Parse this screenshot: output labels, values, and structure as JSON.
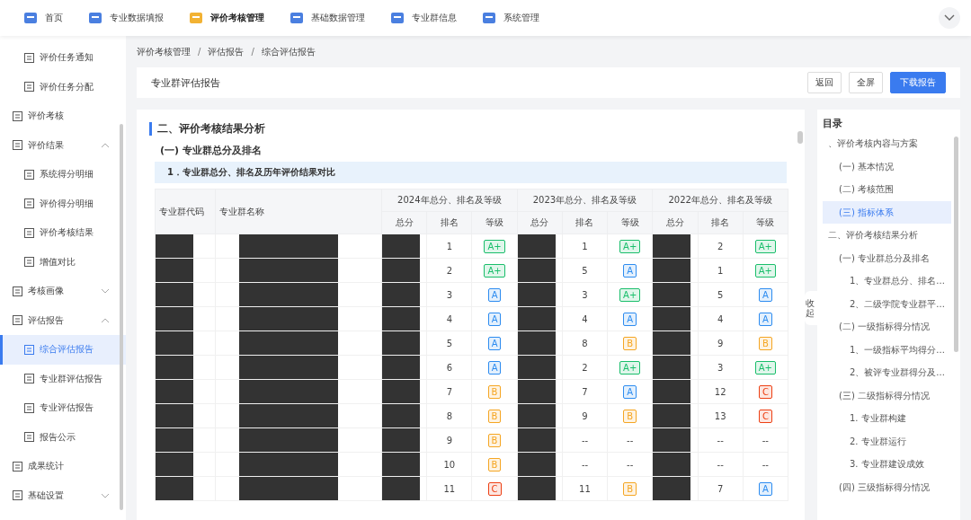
{
  "top_nav": {
    "items": [
      {
        "label": "首页",
        "selected": false
      },
      {
        "label": "专业数据填报",
        "selected": false
      },
      {
        "label": "评价考核管理",
        "selected": true
      },
      {
        "label": "基础数据管理",
        "selected": false
      },
      {
        "label": "专业群信息",
        "selected": false
      },
      {
        "label": "系统管理",
        "selected": false
      }
    ]
  },
  "sidebar": {
    "items": [
      {
        "label": "评价任务通知",
        "kind": "sub",
        "selected": false
      },
      {
        "label": "评价任务分配",
        "kind": "sub",
        "selected": false
      },
      {
        "label": "评价考核",
        "kind": "group",
        "selected": false
      },
      {
        "label": "评价结果",
        "kind": "folder",
        "expanded": true,
        "selected": false
      },
      {
        "label": "系统得分明细",
        "kind": "sub",
        "selected": false
      },
      {
        "label": "评价得分明细",
        "kind": "sub",
        "selected": false
      },
      {
        "label": "评价考核结果",
        "kind": "sub",
        "selected": false
      },
      {
        "label": "增值对比",
        "kind": "sub",
        "selected": false
      },
      {
        "label": "考核画像",
        "kind": "folder",
        "expanded": false,
        "selected": false
      },
      {
        "label": "评估报告",
        "kind": "folder",
        "expanded": true,
        "selected": false
      },
      {
        "label": "综合评估报告",
        "kind": "sub",
        "selected": true
      },
      {
        "label": "专业群评估报告",
        "kind": "sub",
        "selected": false
      },
      {
        "label": "专业评估报告",
        "kind": "sub",
        "selected": false
      },
      {
        "label": "报告公示",
        "kind": "sub",
        "selected": false
      },
      {
        "label": "成果统计",
        "kind": "group",
        "selected": false
      },
      {
        "label": "基础设置",
        "kind": "folder",
        "expanded": false,
        "selected": false
      }
    ]
  },
  "breadcrumb": [
    "评价考核管理",
    "评估报告",
    "综合评估报告"
  ],
  "breadcrumb_separator": "/",
  "page_title": "专业群评估报告",
  "buttons": [
    {
      "label": "返回",
      "kind": "plain"
    },
    {
      "label": "全屏",
      "kind": "plain"
    },
    {
      "label": "下载报告",
      "kind": "primary"
    }
  ],
  "report": {
    "section_title": "二、评价考核结果分析",
    "subsection_title": "(一) 专业群总分及排名",
    "table_caption": "1．专业群总分、排名及历年评价结果对比",
    "table": {
      "fixed_columns": [
        "专业群代码",
        "专业群名称"
      ],
      "groups": [
        {
          "title": "2024年总分、排名及等级",
          "columns": [
            "总分",
            "排名",
            "等级"
          ]
        },
        {
          "title": "2023年总分、排名及等级",
          "columns": [
            "总分",
            "排名",
            "等级"
          ]
        },
        {
          "title": "2022年总分、排名及等级",
          "columns": [
            "总分",
            "排名",
            "等级"
          ]
        }
      ],
      "rows": [
        {
          "years": [
            {
              "rank": "1",
              "grade": "A+",
              "color": "#19be6b"
            },
            {
              "rank": "1",
              "grade": "A+",
              "color": "#19be6b"
            },
            {
              "rank": "2",
              "grade": "A+",
              "color": "#19be6b"
            }
          ]
        },
        {
          "years": [
            {
              "rank": "2",
              "grade": "A+",
              "color": "#19be6b"
            },
            {
              "rank": "5",
              "grade": "A",
              "color": "#2d8cf0"
            },
            {
              "rank": "1",
              "grade": "A+",
              "color": "#19be6b"
            }
          ]
        },
        {
          "years": [
            {
              "rank": "3",
              "grade": "A",
              "color": "#2d8cf0"
            },
            {
              "rank": "3",
              "grade": "A+",
              "color": "#19be6b"
            },
            {
              "rank": "5",
              "grade": "A",
              "color": "#2d8cf0"
            }
          ]
        },
        {
          "years": [
            {
              "rank": "4",
              "grade": "A",
              "color": "#2d8cf0"
            },
            {
              "rank": "4",
              "grade": "A",
              "color": "#2d8cf0"
            },
            {
              "rank": "4",
              "grade": "A",
              "color": "#2d8cf0"
            }
          ]
        },
        {
          "years": [
            {
              "rank": "5",
              "grade": "A",
              "color": "#2d8cf0"
            },
            {
              "rank": "8",
              "grade": "B",
              "color": "#f5a623"
            },
            {
              "rank": "9",
              "grade": "B",
              "color": "#f5a623"
            }
          ]
        },
        {
          "years": [
            {
              "rank": "6",
              "grade": "A",
              "color": "#2d8cf0"
            },
            {
              "rank": "2",
              "grade": "A+",
              "color": "#19be6b"
            },
            {
              "rank": "3",
              "grade": "A+",
              "color": "#19be6b"
            }
          ]
        },
        {
          "years": [
            {
              "rank": "7",
              "grade": "B",
              "color": "#f5a623"
            },
            {
              "rank": "7",
              "grade": "A",
              "color": "#2d8cf0"
            },
            {
              "rank": "12",
              "grade": "C",
              "color": "#ed4014"
            }
          ]
        },
        {
          "years": [
            {
              "rank": "8",
              "grade": "B",
              "color": "#f5a623"
            },
            {
              "rank": "9",
              "grade": "B",
              "color": "#f5a623"
            },
            {
              "rank": "13",
              "grade": "C",
              "color": "#ed4014"
            }
          ]
        },
        {
          "years": [
            {
              "rank": "9",
              "grade": "B",
              "color": "#f5a623"
            },
            {
              "rank": "--",
              "grade": "--"
            },
            {
              "rank": "--",
              "grade": "--"
            }
          ]
        },
        {
          "years": [
            {
              "rank": "10",
              "grade": "B",
              "color": "#f5a623"
            },
            {
              "rank": "--",
              "grade": "--"
            },
            {
              "rank": "--",
              "grade": "--"
            }
          ]
        },
        {
          "years": [
            {
              "rank": "11",
              "grade": "C",
              "color": "#ed4014"
            },
            {
              "rank": "11",
              "grade": "B",
              "color": "#f5a623"
            },
            {
              "rank": "7",
              "grade": "A",
              "color": "#2d8cf0"
            }
          ]
        }
      ]
    }
  },
  "collapse_tab": "收起",
  "toc": {
    "title": "目录",
    "items": [
      {
        "label": "、评价考核内容与方案",
        "selected": false,
        "children": [
          {
            "label": "(一) 基本情况",
            "selected": false
          },
          {
            "label": "(二) 考核范围",
            "selected": false
          },
          {
            "label": "(三) 指标体系",
            "selected": true
          }
        ]
      },
      {
        "label": "二、评价考核结果分析",
        "selected": false,
        "children": [
          {
            "label": "(一) 专业群总分及排名",
            "selected": false,
            "children": [
              {
                "label": "1、专业群总分、排名...",
                "selected": false
              },
              {
                "label": "2、二级学院专业群平...",
                "selected": false
              }
            ]
          },
          {
            "label": "(二) 一级指标得分情况",
            "selected": false,
            "children": [
              {
                "label": "1、一级指标平均得分...",
                "selected": false
              },
              {
                "label": "2、被评专业群得分及...",
                "selected": false
              }
            ]
          },
          {
            "label": "(三) 二级指标得分情况",
            "selected": false,
            "children": [
              {
                "label": "1. 专业群构建",
                "selected": false
              },
              {
                "label": "2. 专业群运行",
                "selected": false
              },
              {
                "label": "3. 专业群建设成效",
                "selected": false
              }
            ]
          },
          {
            "label": "(四) 三级指标得分情况",
            "selected": false
          }
        ]
      }
    ]
  }
}
